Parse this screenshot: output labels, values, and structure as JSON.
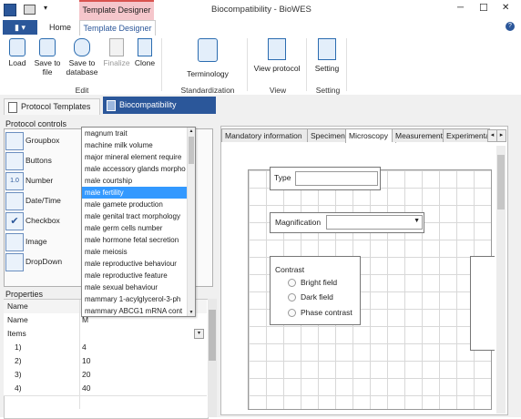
{
  "window": {
    "title": "Biocompatibility - BioWES",
    "context_tab": "Template Designer",
    "min_glyph": "─",
    "max_glyph": "☐",
    "close_glyph": "✕"
  },
  "menu_tabs": [
    {
      "label": "Home"
    },
    {
      "label": "Template Designer"
    }
  ],
  "ribbon": {
    "buttons": [
      {
        "label": "Load"
      },
      {
        "label": "Save to file"
      },
      {
        "label": "Save to database"
      },
      {
        "label": "Finalize"
      },
      {
        "label": "Clone"
      },
      {
        "label": "Terminology"
      },
      {
        "label": "View protocol"
      },
      {
        "label": "Setting"
      }
    ],
    "groups": [
      "Edit",
      "Standardization",
      "View",
      "Setting"
    ]
  },
  "doc_tabs": [
    {
      "label": "Protocol Templates"
    },
    {
      "label": "Biocompatibility"
    }
  ],
  "protocol_controls": {
    "title": "Protocol controls",
    "items": [
      "Groupbox",
      "Buttons",
      "Number",
      "Date/Time",
      "Checkbox",
      "Image",
      "DropDown"
    ],
    "number_icon_text": "1.0"
  },
  "dropdown": {
    "items": [
      "magnum trait",
      "machine milk volume",
      "major mineral element require",
      "male accessory glands morpho",
      "male courtship",
      "male fertility",
      "male gamete production",
      "male genital tract morphology",
      "male germ cells number",
      "male hormone fetal secretion",
      "male meiosis",
      "male reproductive behaviour",
      "male reproductive feature",
      "male sexual behaviour",
      "mammary 1-acylglycerol-3-ph",
      "mammary ABCG1 mRNA cont"
    ],
    "selected": "male fertility"
  },
  "properties": {
    "title": "Properties",
    "header": "Name",
    "rows": [
      {
        "name": "Name",
        "value": "M"
      },
      {
        "name": "Items",
        "value": ""
      },
      {
        "name": "1)",
        "value": "4"
      },
      {
        "name": "2)",
        "value": "10"
      },
      {
        "name": "3)",
        "value": "20"
      },
      {
        "name": "4)",
        "value": "40"
      }
    ]
  },
  "protocol_tabs": [
    {
      "label": "Mandatory information"
    },
    {
      "label": "Specimen"
    },
    {
      "label": "Microscopy"
    },
    {
      "label": "Measurement"
    },
    {
      "label": "Experimenta"
    }
  ],
  "form": {
    "type_label": "Type",
    "magnification_label": "Magnification",
    "contrast_label": "Contrast",
    "contrast_options": [
      "Bright field",
      "Dark field",
      "Phase contrast"
    ]
  },
  "colors": {
    "accent": "#2b579a",
    "context_tab_fill": "#f5c6cb",
    "selection": "#3399ff",
    "active_doc_tab": "#2b579a"
  }
}
